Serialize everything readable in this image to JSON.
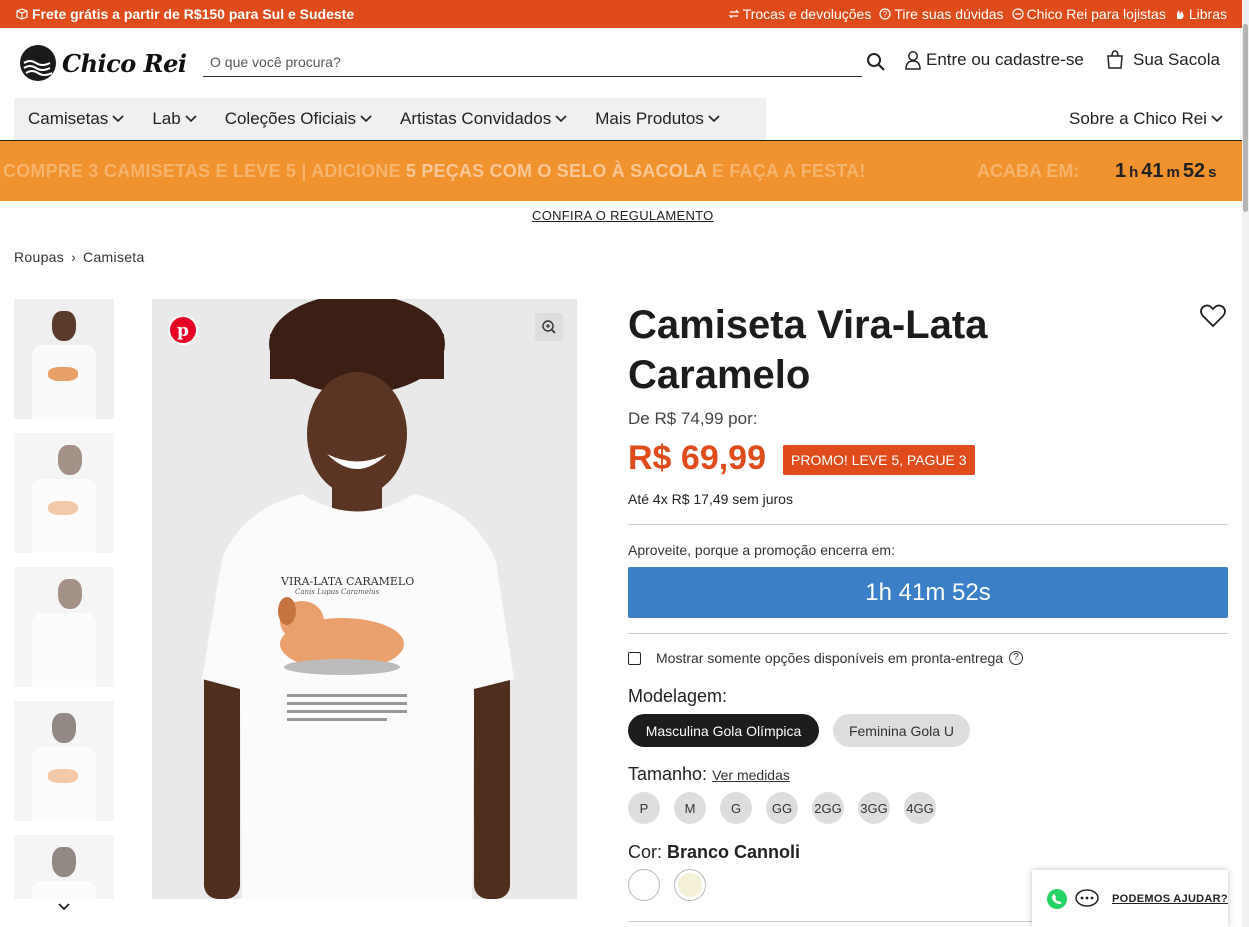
{
  "topbar": {
    "shipping": "Frete grátis a partir de R$150 para Sul e Sudeste",
    "links": [
      "Trocas e devoluções",
      "Tire suas dúvidas",
      "Chico Rei para lojistas",
      "Libras"
    ]
  },
  "header": {
    "logo": "Chico Rei",
    "search_placeholder": "O que você procura?",
    "login": "Entre ou cadastre-se",
    "bag": "Sua Sacola"
  },
  "nav": {
    "items": [
      "Camisetas",
      "Lab",
      "Coleções Oficiais",
      "Artistas Convidados",
      "Mais Produtos"
    ],
    "right": "Sobre a Chico Rei"
  },
  "promo": {
    "part1": "COMPRE 3 CAMISETAS E LEVE 5",
    "sep": " | ",
    "part2": "ADICIONE ",
    "part3": "5 PEÇAS COM O SELO À SACOLA",
    "part4": " E FAÇA A FESTA!",
    "ends": "ACABA EM:",
    "timer": {
      "h": "1",
      "hu": "h",
      "m": "41",
      "mu": "m",
      "s": "52",
      "su": "s"
    },
    "rules": "CONFIRA O REGULAMENTO"
  },
  "breadcrumb": [
    "Roupas",
    "Camiseta"
  ],
  "product": {
    "title": "Camiseta Vira-Lata Caramelo",
    "old_price": "De R$ 74,99 por:",
    "price": "R$ 69,99",
    "badge": "PROMO! LEVE 5, PAGUE 3",
    "installments": "Até 4x R$ 17,49 sem juros",
    "promo_note": "Aproveite, porque a promoção encerra em:",
    "timer": "1h 41m 52s",
    "stock_filter": "Mostrar somente opções disponíveis em pronta-entrega",
    "modelagem_label": "Modelagem:",
    "models": [
      "Masculina Gola Olímpica",
      "Feminina Gola U"
    ],
    "tamanho_label": "Tamanho:",
    "ver_medidas": "Ver medidas",
    "sizes": [
      "P",
      "M",
      "G",
      "GG",
      "2GG",
      "3GG",
      "4GG"
    ],
    "cor_label": "Cor:",
    "cor_value": "Branco Cannoli",
    "colors": [
      "#ffffff",
      "#f4f1d6"
    ]
  },
  "shirt_print": {
    "title": "VIRA-LATA CARAMELO",
    "subtitle": "Canis Lupus Caramelus"
  },
  "help_widget": "PODEMOS AJUDAR?"
}
